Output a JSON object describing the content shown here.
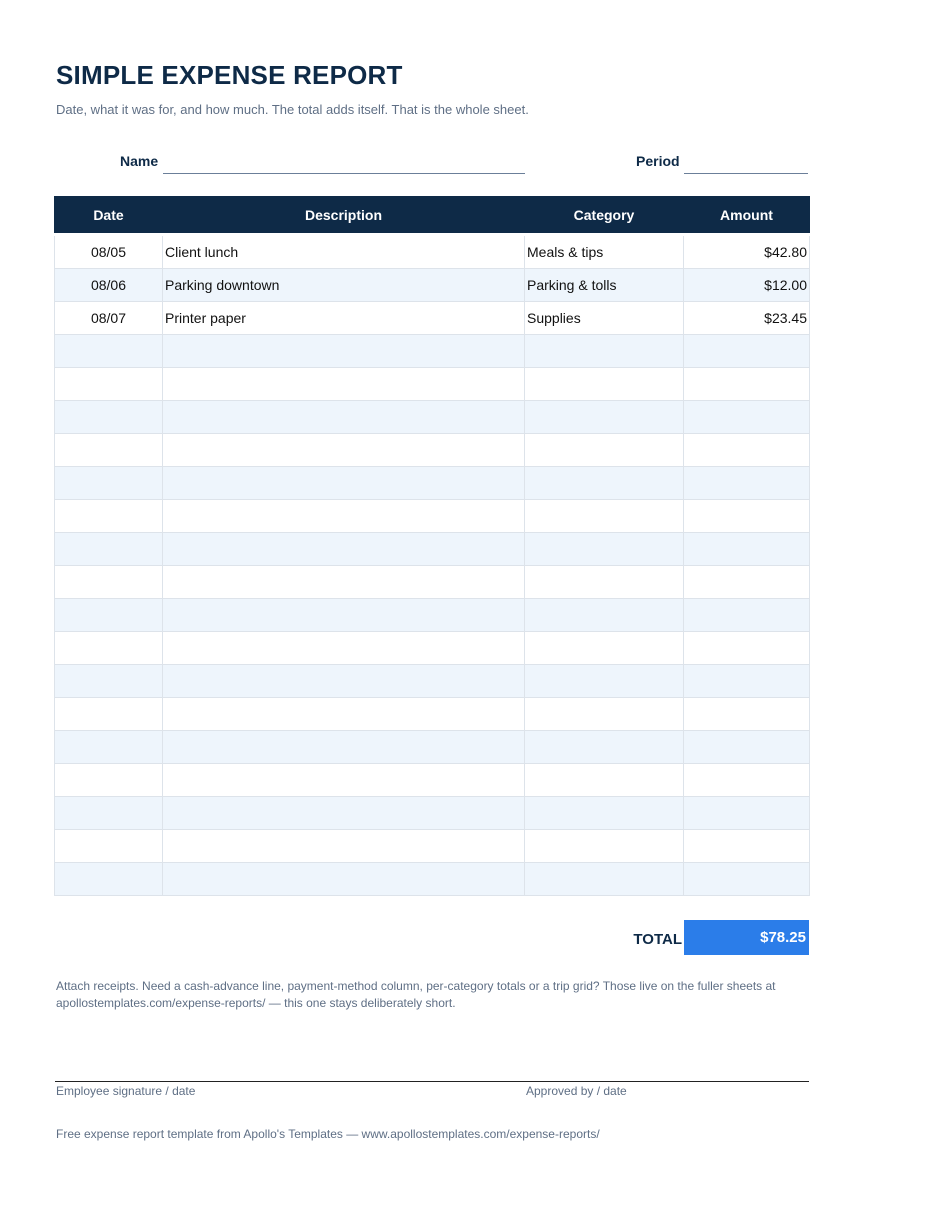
{
  "header": {
    "title": "SIMPLE EXPENSE REPORT",
    "subtitle": "Date, what it was for, and how much. The total adds itself. That is the whole sheet."
  },
  "fields": {
    "name_label": "Name",
    "name_value": "",
    "period_label": "Period",
    "period_value": ""
  },
  "table": {
    "columns": [
      "Date",
      "Description",
      "Category",
      "Amount"
    ],
    "rows": [
      [
        "08/05",
        "Client lunch",
        "Meals & tips",
        "$42.80"
      ],
      [
        "08/06",
        "Parking downtown",
        "Parking & tolls",
        "$12.00"
      ],
      [
        "08/07",
        "Printer paper",
        "Supplies",
        "$23.45"
      ],
      [
        "",
        "",
        "",
        ""
      ],
      [
        "",
        "",
        "",
        ""
      ],
      [
        "",
        "",
        "",
        ""
      ],
      [
        "",
        "",
        "",
        ""
      ],
      [
        "",
        "",
        "",
        ""
      ],
      [
        "",
        "",
        "",
        ""
      ],
      [
        "",
        "",
        "",
        ""
      ],
      [
        "",
        "",
        "",
        ""
      ],
      [
        "",
        "",
        "",
        ""
      ],
      [
        "",
        "",
        "",
        ""
      ],
      [
        "",
        "",
        "",
        ""
      ],
      [
        "",
        "",
        "",
        ""
      ],
      [
        "",
        "",
        "",
        ""
      ],
      [
        "",
        "",
        "",
        ""
      ],
      [
        "",
        "",
        "",
        ""
      ],
      [
        "",
        "",
        "",
        ""
      ],
      [
        "",
        "",
        "",
        ""
      ]
    ]
  },
  "total": {
    "label": "TOTAL",
    "value": "$78.25"
  },
  "note": "Attach receipts. Need a cash-advance line, payment-method column, per-category totals or a trip grid? Those live on the fuller sheets at apollostemplates.com/expense-reports/ — this one stays deliberately short.",
  "signatures": {
    "employee": "Employee signature / date",
    "approver": "Approved by / date"
  },
  "footer": "Free expense report template from Apollo's Templates — www.apollostemplates.com/expense-reports/",
  "colors": {
    "header_navy": "#0e2a47",
    "total_blue": "#2b7de9",
    "stripe": "#eef5fc"
  }
}
